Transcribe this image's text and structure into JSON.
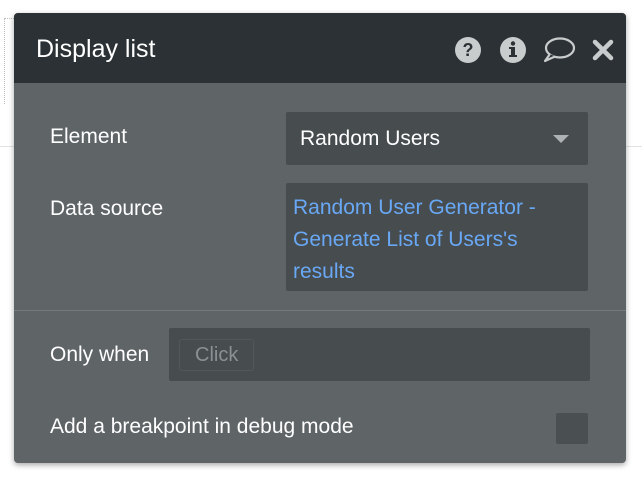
{
  "dialog": {
    "title": "Display list",
    "header_icons": [
      "help-icon",
      "info-icon",
      "comment-icon",
      "close-icon"
    ]
  },
  "fields": {
    "element": {
      "label": "Element",
      "value": "Random Users"
    },
    "data_source": {
      "label": "Data source",
      "value": "Random User Generator - Generate List of Users's results"
    },
    "only_when": {
      "label": "Only when",
      "placeholder": "Click"
    },
    "breakpoint": {
      "label": "Add a breakpoint in debug mode",
      "checked": false
    }
  },
  "colors": {
    "header": "#2b3134",
    "panel": "#5f6467",
    "input": "#474c4f",
    "link": "#69a8f5"
  }
}
